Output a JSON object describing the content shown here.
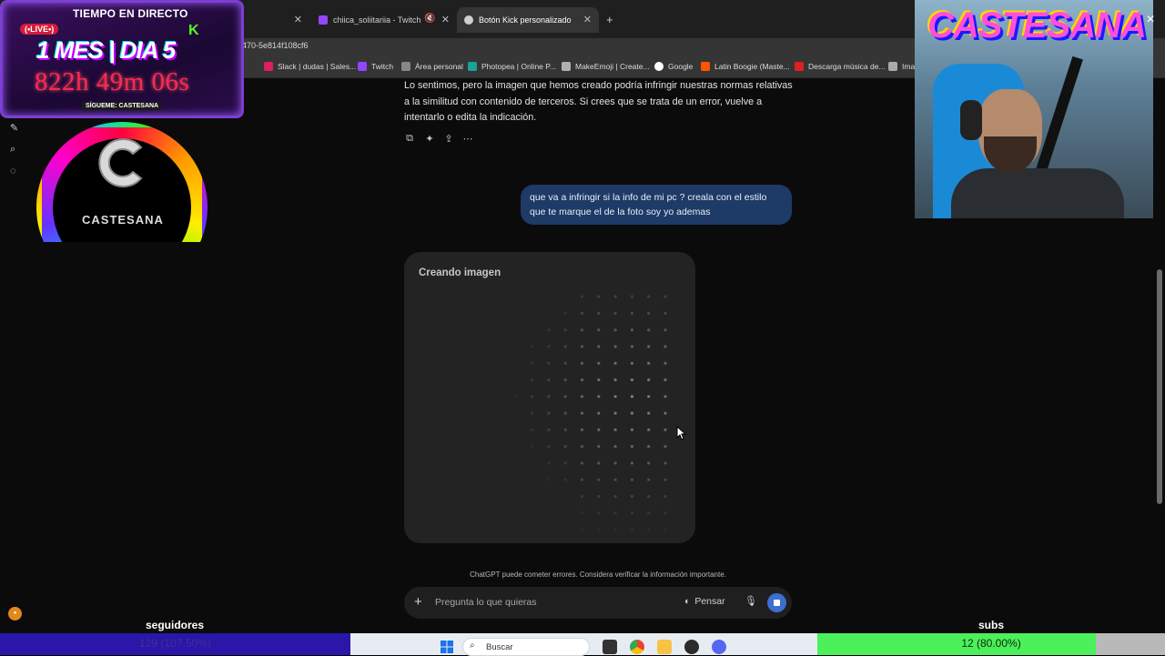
{
  "browser": {
    "tabs": [
      {
        "label": "chiica_soliitariia - Twitch",
        "color": "#9146ff"
      },
      {
        "label": "Botón Kick personalizado",
        "color": "#cfcfcf"
      }
    ],
    "url_fragment": "470-5e814f108cf6",
    "bookmarks": [
      {
        "label": "Slack | dudas | Sales...",
        "color": "#e01e5a"
      },
      {
        "label": "Twitch",
        "color": "#9146ff"
      },
      {
        "label": "Área personal",
        "color": "#888888"
      },
      {
        "label": "Photopea | Online P...",
        "color": "#18a497"
      },
      {
        "label": "MakeEmoji | Create...",
        "color": "#b0b0b0"
      },
      {
        "label": "Google",
        "color": "#ffffff"
      },
      {
        "label": "Latin Boogie (Maste...",
        "color": "#ff5500"
      },
      {
        "label": "Descarga música de...",
        "color": "#e02020"
      },
      {
        "label": "Ima",
        "color": "#aaaaaa"
      }
    ]
  },
  "chat": {
    "assistant_message": "Lo sentimos, pero la imagen que hemos creado podría infringir nuestras normas relativas a la similitud con contenido de terceros. Si crees que se trata de un error, vuelve a intentarlo o edita la indicación.",
    "user_message": "que va a infringir si la info de mi pc ? creala con el estilo que te marque el de la foto soy yo ademas",
    "image_card_title": "Creando imagen",
    "disclaimer": "ChatGPT puede cometer errores. Considera verificar la información importante.",
    "composer_placeholder": "Pregunta lo que quieras",
    "think_label": "Pensar"
  },
  "overlay": {
    "timer_header": "TIEMPO EN DIRECTO",
    "live_badge": "(•LIVE•)",
    "kick_letter": "K",
    "day_label": "1 MES | DIA 5",
    "clock": "822h 49m 06s",
    "follow_text": "SÍGUEME: CASTESANA",
    "logo_text": "CASTESANA",
    "cam_title": "CASTESANA",
    "close_glyph": "✕"
  },
  "goals": {
    "seguidores_label": "seguidores",
    "seguidores_value": "129 (107.50%)",
    "subs_label": "subs",
    "subs_value": "12 (80.00%)",
    "subs_progress": 0.8
  },
  "taskbar": {
    "search_label": "Buscar"
  },
  "colors": {
    "user_bubble": "#1e3a66",
    "stop_button": "#3c6fd0",
    "seguidores_bar": "#2a16a8",
    "subs_bar": "#4cf05a"
  }
}
